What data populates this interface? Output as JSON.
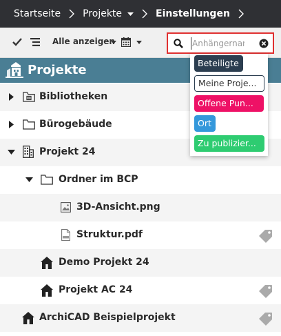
{
  "breadcrumb": {
    "items": [
      "Startseite",
      "Projekte",
      "Einstellungen"
    ]
  },
  "toolbar": {
    "show_all_label": "Alle anzeigen"
  },
  "search": {
    "placeholder": "Anhängernam"
  },
  "projects_header": {
    "title": "Projekte"
  },
  "tree": [
    {
      "label": "Bibliotheken",
      "icon": "library-folder-icon",
      "expander": "collapsed",
      "tagged": false
    },
    {
      "label": "Bürogebäude",
      "icon": "folder-icon",
      "expander": "collapsed",
      "tagged": false
    },
    {
      "label": "Projekt 24",
      "icon": "building-icon",
      "expander": "expanded",
      "tagged": false
    },
    {
      "label": "Ordner im BCP",
      "icon": "folder-icon",
      "expander": "expanded",
      "tagged": false
    },
    {
      "label": "3D-Ansicht.png",
      "icon": "image-file-icon",
      "expander": "none",
      "tagged": false
    },
    {
      "label": "Struktur.pdf",
      "icon": "pdf-file-icon",
      "expander": "none",
      "tagged": true
    },
    {
      "label": "Demo Projekt 24",
      "icon": "archicad-project-icon",
      "expander": "none",
      "tagged": false
    },
    {
      "label": "Projekt AC 24",
      "icon": "archicad-project-icon",
      "expander": "none",
      "tagged": true
    },
    {
      "label": "ArchiCAD Beispielprojekt",
      "icon": "archicad-project-icon",
      "expander": "none",
      "tagged": true
    }
  ],
  "filter_dropdown": {
    "options": [
      {
        "label": "Beteiligte",
        "color": "#2c3e50",
        "text_color": "#ffffff"
      },
      {
        "label": "Meine Proje...",
        "color": "#ffffff",
        "text_color": "#333333"
      },
      {
        "label": "Offene Pun...",
        "color": "#ee1166",
        "text_color": "#ffffff"
      },
      {
        "label": "Ort",
        "color": "#3498db",
        "text_color": "#ffffff"
      },
      {
        "label": "Zu publizier...",
        "color": "#2ecc71",
        "text_color": "#ffffff"
      }
    ]
  },
  "colors": {
    "breadcrumb_bg": "#2f3034",
    "header_bg": "#4a7e94",
    "search_border": "#e03030",
    "tag_icon": "#aaaaaa"
  }
}
